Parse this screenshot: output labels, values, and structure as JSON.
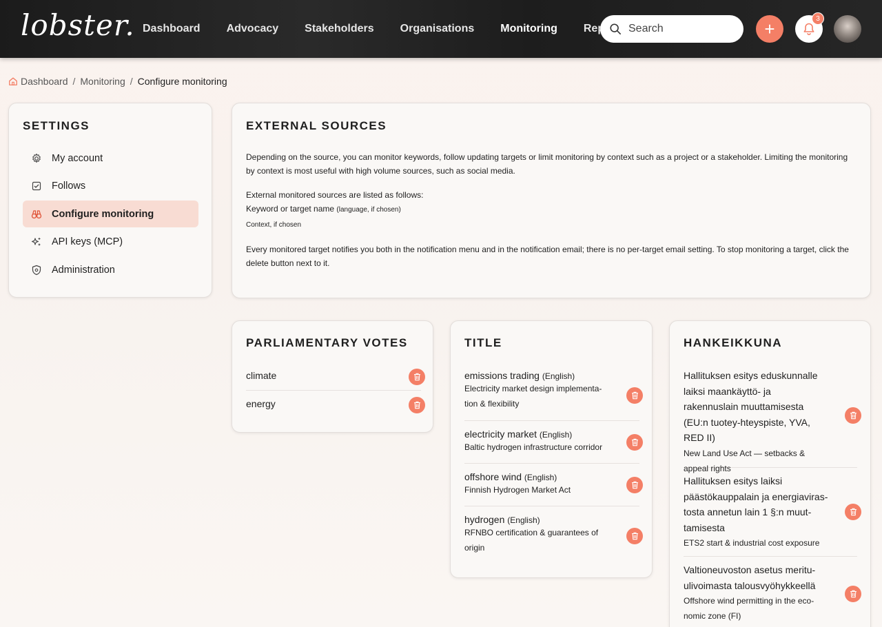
{
  "header": {
    "logo": "lobster.",
    "nav": [
      "Dashboard",
      "Advocacy",
      "Stakeholders",
      "Organisations",
      "Monitoring",
      "Reports"
    ],
    "active_nav": "Monitoring",
    "search_placeholder": "Search",
    "notification_count": "3",
    "accent_color": "#f47f66"
  },
  "breadcrumb": {
    "items": [
      "Dashboard",
      "Monitoring"
    ],
    "current": "Configure monitoring"
  },
  "settings": {
    "title": "SETTINGS",
    "items": [
      {
        "label": "My account",
        "icon": "gear-icon"
      },
      {
        "label": "Follows",
        "icon": "checkbox-icon"
      },
      {
        "label": "Configure monitoring",
        "icon": "binoculars-icon"
      },
      {
        "label": "API keys (MCP)",
        "icon": "sparkle-icon"
      },
      {
        "label": "Administration",
        "icon": "shield-gear-icon"
      }
    ],
    "active": "Configure monitoring"
  },
  "external_sources": {
    "title": "EXTERNAL SOURCES",
    "intro": "Depending on the source, you can monitor keywords, follow updating targets or limit monitoring by context such as a project or a stakeholder. Limiting the monitoring by context is most useful with high volume sources, such as social media.",
    "listed_heading": "External monitored sources are listed as follows:",
    "format_line": "Keyword or target name",
    "format_line_note": "(language, if chosen)",
    "context_line": "Context, if chosen",
    "notify_text": "Every monitored target notifies you both in the notification menu and in the notification email; there is no per-target email setting. To stop monitoring a target, click the delete button next to it."
  },
  "parliamentary_votes": {
    "title": "PARLIAMENTARY VOTES",
    "items": [
      {
        "keyword": "climate"
      },
      {
        "keyword": "energy"
      }
    ]
  },
  "title_source": {
    "title": "TITLE",
    "items": [
      {
        "keyword": "emissions trading",
        "lang": "(English)",
        "context": "Electricity market design implementa-tion & flexibility"
      },
      {
        "keyword": "electricity market",
        "lang": "(English)",
        "context": "Baltic hydrogen infrastructure corridor"
      },
      {
        "keyword": "offshore wind",
        "lang": "(English)",
        "context": "Finnish Hydrogen Market Act"
      },
      {
        "keyword": "hydrogen",
        "lang": "(English)",
        "context": "RFNBO certification & guarantees of origin"
      }
    ]
  },
  "hankeikkuna": {
    "title": "HANKEIKKUNA",
    "items": [
      {
        "keyword": "Hallituksen esitys eduskunnalle laiksi maankäyttö- ja rakennuslain muuttamisesta (EU:n tuotey-hteyspiste, YVA, RED II)",
        "context": "New Land Use Act — setbacks & appeal rights"
      },
      {
        "keyword": "Hallituksen esitys laiksi päästökauppalain ja energiaviras-tosta annetun lain 1 §:n muut-tamisesta",
        "context": "ETS2 start & industrial cost exposure"
      },
      {
        "keyword": "Valtioneuvoston asetus meritu-ulivoimasta talousvyöhykkeellä",
        "context": "Offshore wind permitting in the eco-nomic zone (FI)"
      }
    ]
  }
}
